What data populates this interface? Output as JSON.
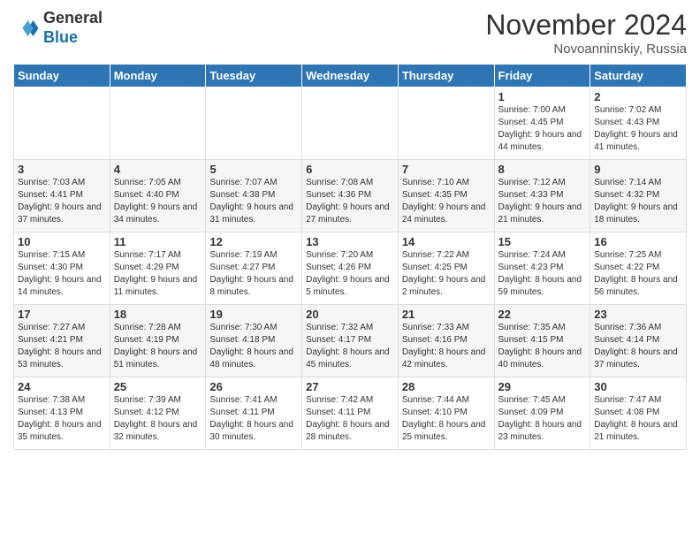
{
  "header": {
    "logo_general": "General",
    "logo_blue": "Blue",
    "month_title": "November 2024",
    "subtitle": "Novoanninskiy, Russia"
  },
  "days_of_week": [
    "Sunday",
    "Monday",
    "Tuesday",
    "Wednesday",
    "Thursday",
    "Friday",
    "Saturday"
  ],
  "weeks": [
    [
      {
        "day": "",
        "info": ""
      },
      {
        "day": "",
        "info": ""
      },
      {
        "day": "",
        "info": ""
      },
      {
        "day": "",
        "info": ""
      },
      {
        "day": "",
        "info": ""
      },
      {
        "day": "1",
        "info": "Sunrise: 7:00 AM\nSunset: 4:45 PM\nDaylight: 9 hours and 44 minutes."
      },
      {
        "day": "2",
        "info": "Sunrise: 7:02 AM\nSunset: 4:43 PM\nDaylight: 9 hours and 41 minutes."
      }
    ],
    [
      {
        "day": "3",
        "info": "Sunrise: 7:03 AM\nSunset: 4:41 PM\nDaylight: 9 hours and 37 minutes."
      },
      {
        "day": "4",
        "info": "Sunrise: 7:05 AM\nSunset: 4:40 PM\nDaylight: 9 hours and 34 minutes."
      },
      {
        "day": "5",
        "info": "Sunrise: 7:07 AM\nSunset: 4:38 PM\nDaylight: 9 hours and 31 minutes."
      },
      {
        "day": "6",
        "info": "Sunrise: 7:08 AM\nSunset: 4:36 PM\nDaylight: 9 hours and 27 minutes."
      },
      {
        "day": "7",
        "info": "Sunrise: 7:10 AM\nSunset: 4:35 PM\nDaylight: 9 hours and 24 minutes."
      },
      {
        "day": "8",
        "info": "Sunrise: 7:12 AM\nSunset: 4:33 PM\nDaylight: 9 hours and 21 minutes."
      },
      {
        "day": "9",
        "info": "Sunrise: 7:14 AM\nSunset: 4:32 PM\nDaylight: 9 hours and 18 minutes."
      }
    ],
    [
      {
        "day": "10",
        "info": "Sunrise: 7:15 AM\nSunset: 4:30 PM\nDaylight: 9 hours and 14 minutes."
      },
      {
        "day": "11",
        "info": "Sunrise: 7:17 AM\nSunset: 4:29 PM\nDaylight: 9 hours and 11 minutes."
      },
      {
        "day": "12",
        "info": "Sunrise: 7:19 AM\nSunset: 4:27 PM\nDaylight: 9 hours and 8 minutes."
      },
      {
        "day": "13",
        "info": "Sunrise: 7:20 AM\nSunset: 4:26 PM\nDaylight: 9 hours and 5 minutes."
      },
      {
        "day": "14",
        "info": "Sunrise: 7:22 AM\nSunset: 4:25 PM\nDaylight: 9 hours and 2 minutes."
      },
      {
        "day": "15",
        "info": "Sunrise: 7:24 AM\nSunset: 4:23 PM\nDaylight: 8 hours and 59 minutes."
      },
      {
        "day": "16",
        "info": "Sunrise: 7:25 AM\nSunset: 4:22 PM\nDaylight: 8 hours and 56 minutes."
      }
    ],
    [
      {
        "day": "17",
        "info": "Sunrise: 7:27 AM\nSunset: 4:21 PM\nDaylight: 8 hours and 53 minutes."
      },
      {
        "day": "18",
        "info": "Sunrise: 7:28 AM\nSunset: 4:19 PM\nDaylight: 8 hours and 51 minutes."
      },
      {
        "day": "19",
        "info": "Sunrise: 7:30 AM\nSunset: 4:18 PM\nDaylight: 8 hours and 48 minutes."
      },
      {
        "day": "20",
        "info": "Sunrise: 7:32 AM\nSunset: 4:17 PM\nDaylight: 8 hours and 45 minutes."
      },
      {
        "day": "21",
        "info": "Sunrise: 7:33 AM\nSunset: 4:16 PM\nDaylight: 8 hours and 42 minutes."
      },
      {
        "day": "22",
        "info": "Sunrise: 7:35 AM\nSunset: 4:15 PM\nDaylight: 8 hours and 40 minutes."
      },
      {
        "day": "23",
        "info": "Sunrise: 7:36 AM\nSunset: 4:14 PM\nDaylight: 8 hours and 37 minutes."
      }
    ],
    [
      {
        "day": "24",
        "info": "Sunrise: 7:38 AM\nSunset: 4:13 PM\nDaylight: 8 hours and 35 minutes."
      },
      {
        "day": "25",
        "info": "Sunrise: 7:39 AM\nSunset: 4:12 PM\nDaylight: 8 hours and 32 minutes."
      },
      {
        "day": "26",
        "info": "Sunrise: 7:41 AM\nSunset: 4:11 PM\nDaylight: 8 hours and 30 minutes."
      },
      {
        "day": "27",
        "info": "Sunrise: 7:42 AM\nSunset: 4:11 PM\nDaylight: 8 hours and 28 minutes."
      },
      {
        "day": "28",
        "info": "Sunrise: 7:44 AM\nSunset: 4:10 PM\nDaylight: 8 hours and 25 minutes."
      },
      {
        "day": "29",
        "info": "Sunrise: 7:45 AM\nSunset: 4:09 PM\nDaylight: 8 hours and 23 minutes."
      },
      {
        "day": "30",
        "info": "Sunrise: 7:47 AM\nSunset: 4:08 PM\nDaylight: 8 hours and 21 minutes."
      }
    ]
  ]
}
